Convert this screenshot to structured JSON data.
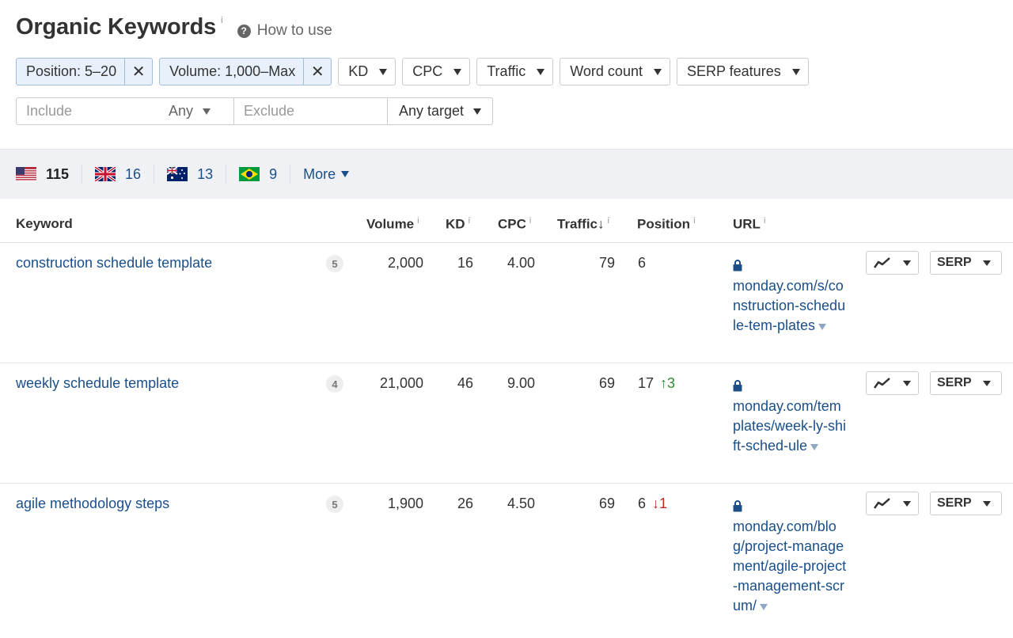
{
  "header": {
    "title": "Organic Keywords",
    "info": "i",
    "how_to_use": "How to use"
  },
  "filters": {
    "active": [
      {
        "label": "Position: 5–20"
      },
      {
        "label": "Volume: 1,000–Max"
      }
    ],
    "dropdowns": [
      "KD",
      "CPC",
      "Traffic",
      "Word count",
      "SERP features"
    ]
  },
  "search": {
    "include_placeholder": "Include",
    "any_label": "Any",
    "exclude_placeholder": "Exclude",
    "target_label": "Any target"
  },
  "countries": [
    {
      "flag": "us-flag-icon",
      "count": "115"
    },
    {
      "flag": "uk-flag-icon",
      "count": "16"
    },
    {
      "flag": "au-flag-icon",
      "count": "13"
    },
    {
      "flag": "br-flag-icon",
      "count": "9"
    }
  ],
  "more_label": "More",
  "table": {
    "headers": {
      "keyword": "Keyword",
      "volume": "Volume",
      "kd": "KD",
      "cpc": "CPC",
      "traffic": "Traffic",
      "traffic_sort": "↓",
      "position": "Position",
      "url": "URL",
      "info": "i"
    },
    "serp_label": "SERP",
    "rows": [
      {
        "keyword": "construction schedule template",
        "words": "5",
        "volume": "2,000",
        "kd": "16",
        "cpc": "4.00",
        "traffic": "79",
        "position": "6",
        "change": "",
        "change_dir": "",
        "url": "monday.com/s/construction-schedule-tem-plates"
      },
      {
        "keyword": "weekly schedule template",
        "words": "4",
        "volume": "21,000",
        "kd": "46",
        "cpc": "9.00",
        "traffic": "69",
        "position": "17",
        "change": "↑3",
        "change_dir": "up",
        "url": "monday.com/templates/week-ly-shift-sched-ule"
      },
      {
        "keyword": "agile methodology steps",
        "words": "5",
        "volume": "1,900",
        "kd": "26",
        "cpc": "4.50",
        "traffic": "69",
        "position": "6",
        "change": "↓1",
        "change_dir": "down",
        "url": "monday.com/blog/project-management/agile-project-management-scrum/"
      }
    ]
  },
  "colors": {
    "link": "#1a4f8a",
    "chip_bg": "#e8f0fb",
    "chip_border": "#9fbde0",
    "up": "#2e8b2e",
    "down": "#c62828"
  }
}
